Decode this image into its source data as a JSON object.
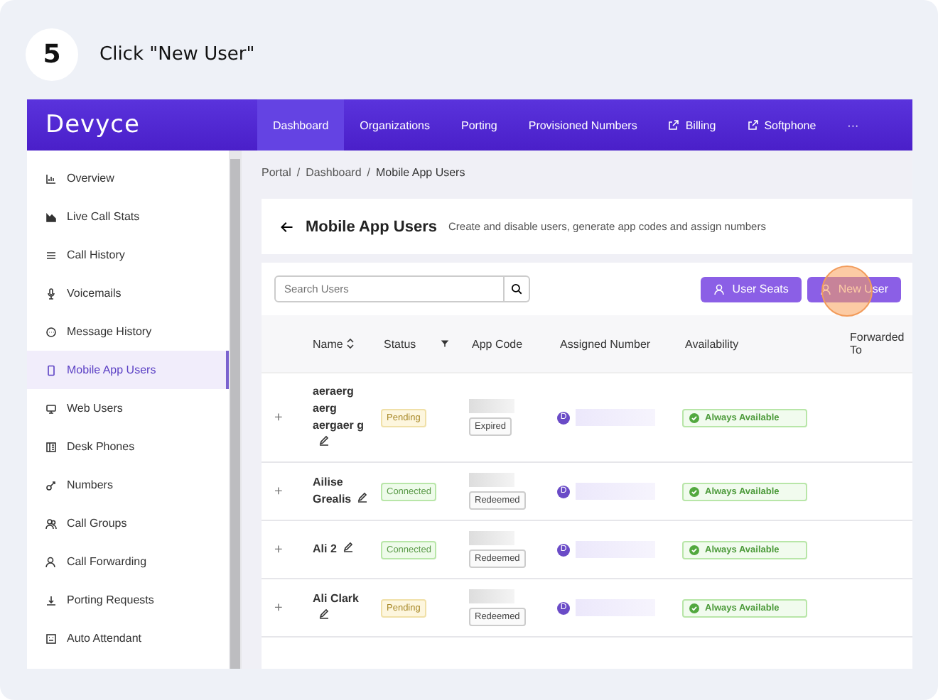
{
  "step": {
    "number": "5",
    "instruction": "Click \"New User\""
  },
  "topbar": {
    "logo": "Devyce",
    "nav": [
      {
        "label": "Dashboard",
        "selected": true,
        "external": false
      },
      {
        "label": "Organizations",
        "selected": false,
        "external": false
      },
      {
        "label": "Porting",
        "selected": false,
        "external": false
      },
      {
        "label": "Provisioned Numbers",
        "selected": false,
        "external": false
      },
      {
        "label": "Billing",
        "selected": false,
        "external": true
      },
      {
        "label": "Softphone",
        "selected": false,
        "external": true
      },
      {
        "label": "···",
        "selected": false,
        "external": false
      }
    ]
  },
  "sidebar": {
    "items": [
      {
        "label": "Overview",
        "kind": "chart",
        "selected": false
      },
      {
        "label": "Live Call Stats",
        "kind": "area",
        "selected": false
      },
      {
        "label": "Call History",
        "kind": "list",
        "selected": false
      },
      {
        "label": "Voicemails",
        "kind": "mic",
        "selected": false
      },
      {
        "label": "Message History",
        "kind": "chat",
        "selected": false
      },
      {
        "label": "Mobile App Users",
        "kind": "mobile",
        "selected": true
      },
      {
        "label": "Web Users",
        "kind": "monitor",
        "selected": false
      },
      {
        "label": "Desk Phones",
        "kind": "desk",
        "selected": false
      },
      {
        "label": "Numbers",
        "kind": "link",
        "selected": false
      },
      {
        "label": "Call Groups",
        "kind": "group",
        "selected": false
      },
      {
        "label": "Call Forwarding",
        "kind": "user",
        "selected": false
      },
      {
        "label": "Porting Requests",
        "kind": "download",
        "selected": false
      },
      {
        "label": "Auto Attendant",
        "kind": "robot",
        "selected": false
      }
    ]
  },
  "breadcrumb": {
    "items": [
      "Portal",
      "Dashboard",
      "Mobile App Users"
    ],
    "separators": [
      "/",
      "/"
    ]
  },
  "page": {
    "title": "Mobile App Users",
    "subtitle": "Create and disable users, generate app codes and assign numbers"
  },
  "search": {
    "placeholder": "Search Users"
  },
  "buttons": [
    "User Seats",
    "New User"
  ],
  "table": {
    "columns": [
      "Name",
      "Status",
      "App Code",
      "Assigned Number",
      "Availability",
      "Forwarded To"
    ],
    "rows": [
      {
        "expand": "+",
        "name": "aeraerg aerg aergaer g",
        "status": "Pending",
        "kind": "pending",
        "code_state": "Expired",
        "number_badge": "D",
        "availability": "Always Available"
      },
      {
        "expand": "+",
        "name": "Ailise Grealis",
        "status": "Connected",
        "kind": "connected",
        "code_state": "Redeemed",
        "number_badge": "D",
        "availability": "Always Available"
      },
      {
        "expand": "+",
        "name": "Ali 2",
        "status": "Connected",
        "kind": "connected",
        "code_state": "Redeemed",
        "number_badge": "D",
        "availability": "Always Available"
      },
      {
        "expand": "+",
        "name": "Ali Clark",
        "status": "Pending",
        "kind": "pending",
        "code_state": "Redeemed",
        "number_badge": "D",
        "availability": "Always Available"
      }
    ]
  }
}
